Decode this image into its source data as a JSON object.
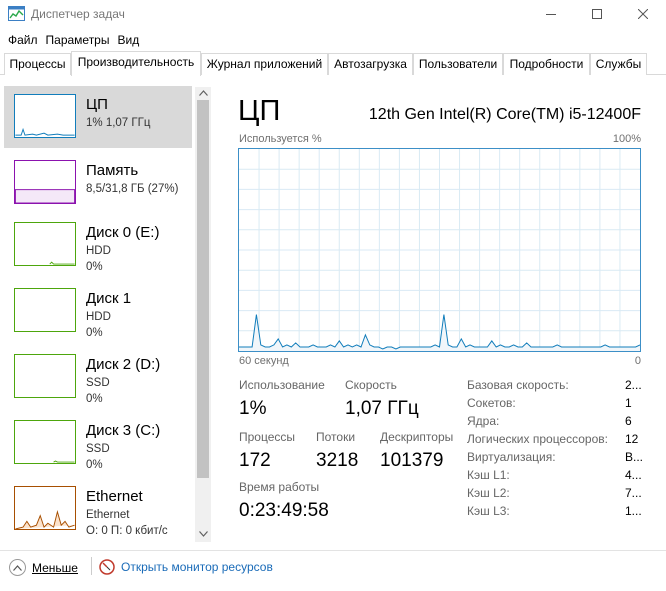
{
  "window": {
    "title": "Диспетчер задач"
  },
  "menu": [
    "Файл",
    "Параметры",
    "Вид"
  ],
  "tabs": [
    "Процессы",
    "Производительность",
    "Журнал приложений",
    "Автозагрузка",
    "Пользователи",
    "Подробности",
    "Службы"
  ],
  "active_tab": "Производительность",
  "resources": [
    {
      "name": "ЦП",
      "line1": "1% 1,07 ГГц",
      "line2": "",
      "color": "#117dbb",
      "selected": true
    },
    {
      "name": "Память",
      "line1": "8,5/31,8 ГБ (27%)",
      "line2": "",
      "color": "#8b12ae",
      "selected": false
    },
    {
      "name": "Диск 0 (E:)",
      "line1": "HDD",
      "line2": "0%",
      "color": "#4da60c",
      "selected": false
    },
    {
      "name": "Диск 1",
      "line1": "HDD",
      "line2": "0%",
      "color": "#4da60c",
      "selected": false
    },
    {
      "name": "Диск 2 (D:)",
      "line1": "SSD",
      "line2": "0%",
      "color": "#4da60c",
      "selected": false
    },
    {
      "name": "Диск 3 (C:)",
      "line1": "SSD",
      "line2": "0%",
      "color": "#4da60c",
      "selected": false
    },
    {
      "name": "Ethernet",
      "line1": "Ethernet",
      "line2": "О: 0 П: 0 кбит/с",
      "color": "#a74f01",
      "selected": false
    }
  ],
  "cpu": {
    "title": "ЦП",
    "model": "12th Gen Intel(R) Core(TM) i5-12400F",
    "usage_axis_label": "Используется %",
    "usage_axis_max": "100%",
    "time_axis_label": "60 секунд",
    "time_axis_min": "0",
    "graph_values": [
      2,
      2,
      2,
      2,
      18,
      3,
      2,
      2,
      3,
      6,
      2,
      3,
      2,
      4,
      2,
      2,
      2,
      3,
      2,
      2,
      2,
      3,
      2,
      5,
      2,
      3,
      2,
      3,
      2,
      8,
      3,
      2,
      2,
      1,
      2,
      2,
      1,
      2,
      2,
      2,
      2,
      2,
      2,
      2,
      2,
      3,
      2,
      18,
      3,
      2,
      2,
      6,
      2,
      3,
      2,
      2,
      2,
      2,
      5,
      2,
      3,
      2,
      2,
      3,
      2,
      2,
      4,
      2,
      2,
      2,
      2,
      2,
      2,
      3,
      2,
      2,
      2,
      2,
      2,
      2,
      2,
      2,
      2,
      2,
      3,
      2,
      2,
      2,
      2,
      2,
      2,
      2,
      3
    ],
    "stats": {
      "usage_label": "Использование",
      "usage_value": "1%",
      "speed_label": "Скорость",
      "speed_value": "1,07 ГГц",
      "processes_label": "Процессы",
      "processes_value": "172",
      "threads_label": "Потоки",
      "threads_value": "3218",
      "handles_label": "Дескрипторы",
      "handles_value": "101379",
      "uptime_label": "Время работы",
      "uptime_value": "0:23:49:58"
    },
    "specs": [
      {
        "label": "Базовая скорость:",
        "value": "2..."
      },
      {
        "label": "Сокетов:",
        "value": "1"
      },
      {
        "label": "Ядра:",
        "value": "6"
      },
      {
        "label": "Логических процессоров:",
        "value": "12"
      },
      {
        "label": "Виртуализация:",
        "value": "В..."
      },
      {
        "label": "Кэш L1:",
        "value": "4..."
      },
      {
        "label": "Кэш L2:",
        "value": "7..."
      },
      {
        "label": "Кэш L3:",
        "value": "1..."
      }
    ]
  },
  "footer": {
    "fewer_label": "Меньше",
    "monitor_label": "Открыть монитор ресурсов"
  }
}
